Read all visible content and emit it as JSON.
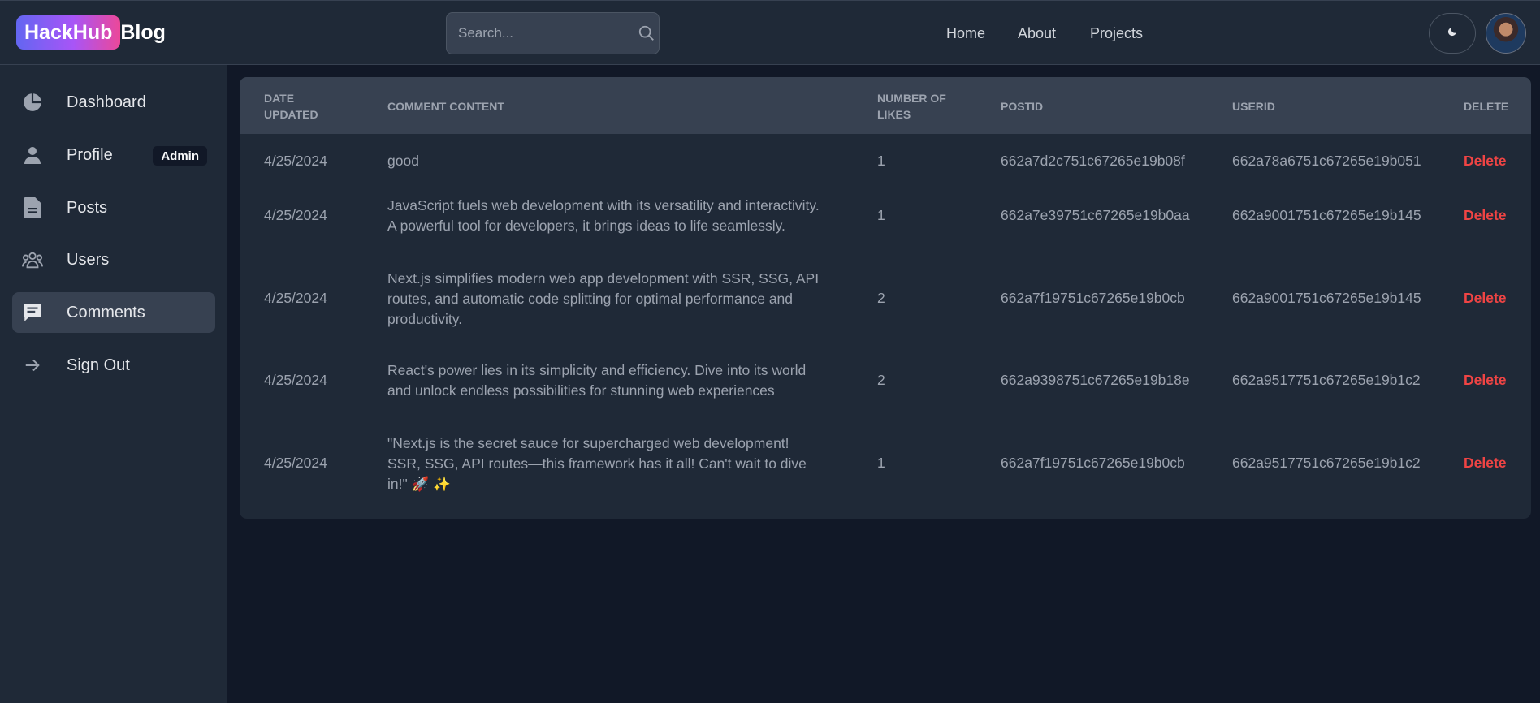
{
  "header": {
    "logo_badge": "HackHub",
    "logo_text": "Blog",
    "search_placeholder": "Search...",
    "nav": [
      "Home",
      "About",
      "Projects"
    ]
  },
  "sidebar": {
    "items": [
      {
        "label": "Dashboard",
        "icon": "pie-chart-icon"
      },
      {
        "label": "Profile",
        "icon": "user-icon",
        "badge": "Admin"
      },
      {
        "label": "Posts",
        "icon": "document-icon"
      },
      {
        "label": "Users",
        "icon": "users-icon"
      },
      {
        "label": "Comments",
        "icon": "comment-icon",
        "active": true
      },
      {
        "label": "Sign Out",
        "icon": "arrow-right-icon"
      }
    ]
  },
  "table": {
    "headers": {
      "date": "DATE UPDATED",
      "content": "COMMENT CONTENT",
      "likes": "NUMBER OF LIKES",
      "postid": "POSTID",
      "userid": "USERID",
      "delete": "DELETE"
    },
    "rows": [
      {
        "date": "4/25/2024",
        "content": "good",
        "likes": "1",
        "postid": "662a7d2c751c67265e19b08f",
        "userid": "662a78a6751c67265e19b051",
        "action": "Delete"
      },
      {
        "date": "4/25/2024",
        "content": "JavaScript fuels web development with its versatility and interactivity. A powerful tool for developers, it brings ideas to life seamlessly.",
        "likes": "1",
        "postid": "662a7e39751c67265e19b0aa",
        "userid": "662a9001751c67265e19b145",
        "action": "Delete"
      },
      {
        "date": "4/25/2024",
        "content": "Next.js simplifies modern web app development with SSR, SSG, API routes, and automatic code splitting for optimal performance and productivity.",
        "likes": "2",
        "postid": "662a7f19751c67265e19b0cb",
        "userid": "662a9001751c67265e19b145",
        "action": "Delete"
      },
      {
        "date": "4/25/2024",
        "content": "React's power lies in its simplicity and efficiency. Dive into its world and unlock endless possibilities for stunning web experiences",
        "likes": "2",
        "postid": "662a9398751c67265e19b18e",
        "userid": "662a9517751c67265e19b1c2",
        "action": "Delete"
      },
      {
        "date": "4/25/2024",
        "content": "\"Next.js is the secret sauce for supercharged web development! SSR, SSG, API routes—this framework has it all! Can't wait to dive in!\" 🚀 ✨",
        "likes": "1",
        "postid": "662a7f19751c67265e19b0cb",
        "userid": "662a9517751c67265e19b1c2",
        "action": "Delete"
      }
    ]
  },
  "colors": {
    "background": "#111827",
    "panel": "#1f2937",
    "header_row": "#374151",
    "delete": "#ef4444",
    "logo_gradient": [
      "#6366f1",
      "#a855f7",
      "#ec4899"
    ]
  }
}
